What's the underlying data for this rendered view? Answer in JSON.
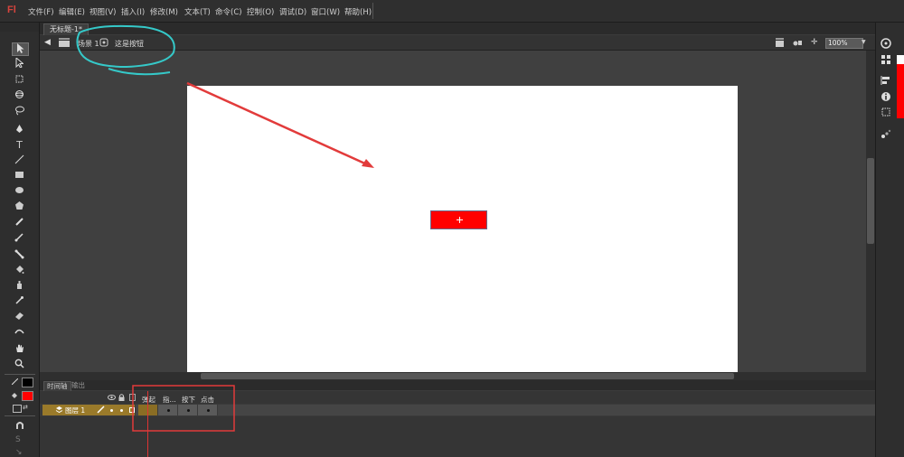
{
  "app": {
    "logo": "Fl"
  },
  "menu": [
    "文件(F)",
    "编辑(E)",
    "视图(V)",
    "插入(I)",
    "修改(M)",
    "文本(T)",
    "命令(C)",
    "控制(O)",
    "调试(D)",
    "窗口(W)",
    "帮助(H)"
  ],
  "document": {
    "tab_label": "无标题-1*"
  },
  "editbar": {
    "scene_label": "场景 1",
    "symbol_label": "这是按钮",
    "zoom": "100%"
  },
  "timeline": {
    "tab_timeline": "时间轴",
    "tab_output": "输出",
    "layer_name": "图层 1",
    "frame_labels": [
      "弹起",
      "指...",
      "按下",
      "点击"
    ]
  },
  "colors": {
    "stage": "#ffffff",
    "button_fill": "#ff0000",
    "annotation_cyan": "#35c9c9",
    "annotation_red": "#e23b3b",
    "layer_highlight": "#9a7a2a"
  },
  "icons": [
    "selection-tool",
    "subselection-tool",
    "free-transform-tool",
    "3d-rotation-tool",
    "lasso-tool",
    "pen-tool",
    "text-tool",
    "line-tool",
    "rectangle-tool",
    "oval-tool",
    "polystar-tool",
    "pencil-tool",
    "brush-tool",
    "bone-tool",
    "paint-bucket-tool",
    "ink-bottle-tool",
    "eyedropper-tool",
    "eraser-tool",
    "width-tool",
    "hand-tool",
    "zoom-tool"
  ]
}
